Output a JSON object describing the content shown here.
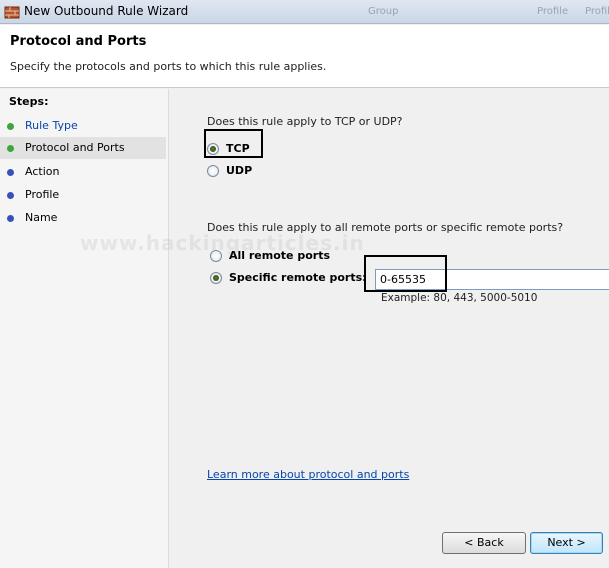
{
  "window": {
    "title": "New Outbound Rule Wizard",
    "background_tabs": [
      "Group",
      "Profile",
      "Profile"
    ]
  },
  "header": {
    "title": "Protocol and Ports",
    "description": "Specify the protocols and ports to which this rule applies."
  },
  "steps": {
    "heading": "Steps:",
    "items": [
      {
        "label": "Rule Type",
        "state": "done",
        "dot_color": "#3ca53c"
      },
      {
        "label": "Protocol and Ports",
        "state": "current",
        "dot_color": "#3ca53c"
      },
      {
        "label": "Action",
        "state": "pending",
        "dot_color": "#3b4fb8"
      },
      {
        "label": "Profile",
        "state": "pending",
        "dot_color": "#3b4fb8"
      },
      {
        "label": "Name",
        "state": "pending",
        "dot_color": "#3b4fb8"
      }
    ]
  },
  "protocol": {
    "question": "Does this rule apply to TCP or UDP?",
    "options": [
      {
        "label": "TCP",
        "selected": true
      },
      {
        "label": "UDP",
        "selected": false
      }
    ]
  },
  "ports": {
    "question": "Does this rule apply to all remote ports or specific remote ports?",
    "options": [
      {
        "label": "All remote ports",
        "selected": false
      },
      {
        "label": "Specific remote ports:",
        "selected": true
      }
    ],
    "value": "0-65535",
    "example": "Example: 80, 443, 5000-5010"
  },
  "watermark": "www.hackingarticles.in",
  "learn_more_link": "Learn more about protocol and ports",
  "buttons": {
    "back": "< Back",
    "next": "Next >"
  },
  "colors": {
    "link": "#0645ad",
    "highlight_box": "#000000"
  }
}
